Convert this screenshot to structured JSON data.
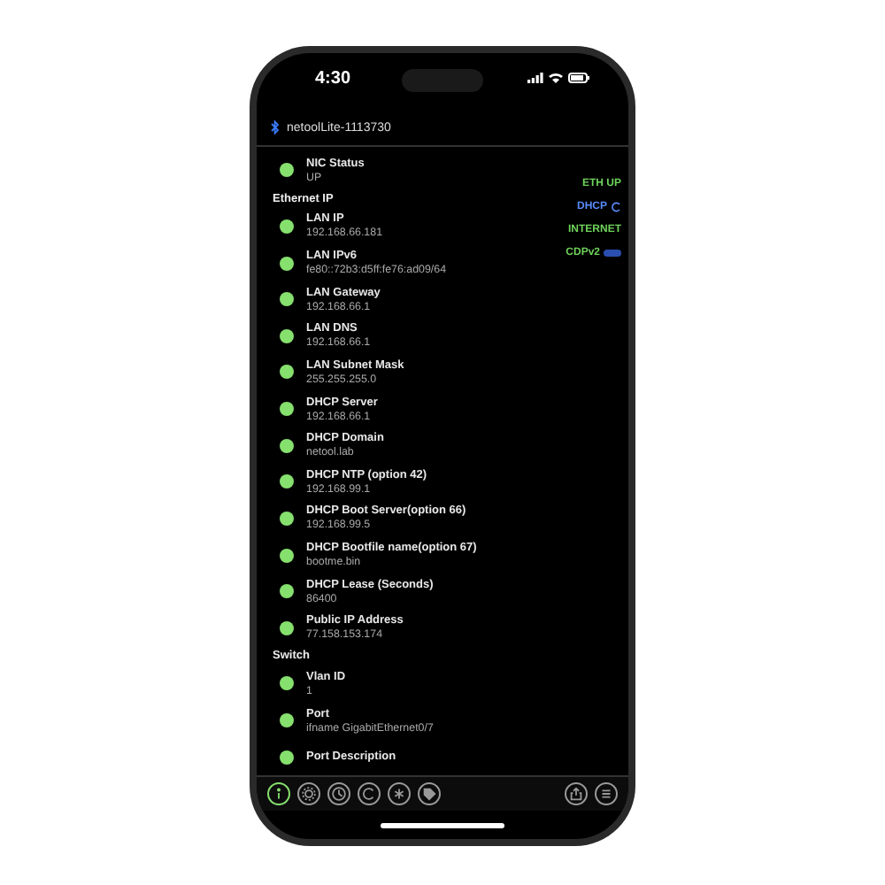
{
  "status_bar": {
    "time": "4:30"
  },
  "header": {
    "device": "netoolLite-1113730"
  },
  "sections": [
    {
      "items": [
        {
          "label": "NIC Status",
          "value": "UP"
        }
      ]
    },
    {
      "title": "Ethernet IP",
      "items": [
        {
          "label": "LAN IP",
          "value": "192.168.66.181"
        },
        {
          "label": "LAN IPv6",
          "value": "fe80::72b3:d5ff:fe76:ad09/64"
        },
        {
          "label": "LAN Gateway",
          "value": "192.168.66.1"
        },
        {
          "label": "LAN DNS",
          "value": "192.168.66.1"
        },
        {
          "label": "LAN Subnet Mask",
          "value": "255.255.255.0"
        },
        {
          "label": "DHCP Server",
          "value": "192.168.66.1"
        },
        {
          "label": "DHCP Domain",
          "value": "netool.lab"
        },
        {
          "label": "DHCP NTP (option 42)",
          "value": "192.168.99.1"
        },
        {
          "label": "DHCP Boot Server(option 66)",
          "value": "192.168.99.5"
        },
        {
          "label": "DHCP Bootfile name(option 67)",
          "value": "bootme.bin"
        },
        {
          "label": "DHCP Lease (Seconds)",
          "value": "86400"
        },
        {
          "label": "Public IP Address",
          "value": "77.158.153.174"
        }
      ]
    },
    {
      "title": "Switch",
      "items": [
        {
          "label": "Vlan ID",
          "value": "1"
        },
        {
          "label": "Port",
          "value": "ifname GigabitEthernet0/7"
        },
        {
          "label": "Port Description",
          "value": null
        }
      ]
    }
  ],
  "indicators": [
    {
      "label": "ETH UP",
      "color": "#6fd35a",
      "kind": "plain"
    },
    {
      "label": "DHCP",
      "color": "#5b8cff",
      "kind": "refresh"
    },
    {
      "label": "INTERNET",
      "color": "#6fd35a",
      "kind": "plain"
    },
    {
      "label": "CDPv2",
      "color": "#6fd35a",
      "kind": "tag"
    }
  ],
  "toolbar": [
    {
      "kind": "info",
      "selected": true
    },
    {
      "kind": "gear",
      "selected": false
    },
    {
      "kind": "clock",
      "selected": false
    },
    {
      "kind": "refresh",
      "selected": false
    },
    {
      "kind": "star",
      "selected": false
    },
    {
      "kind": "tag",
      "selected": false
    },
    {
      "kind": "spacer"
    },
    {
      "kind": "share",
      "selected": false
    },
    {
      "kind": "list",
      "selected": false
    }
  ]
}
